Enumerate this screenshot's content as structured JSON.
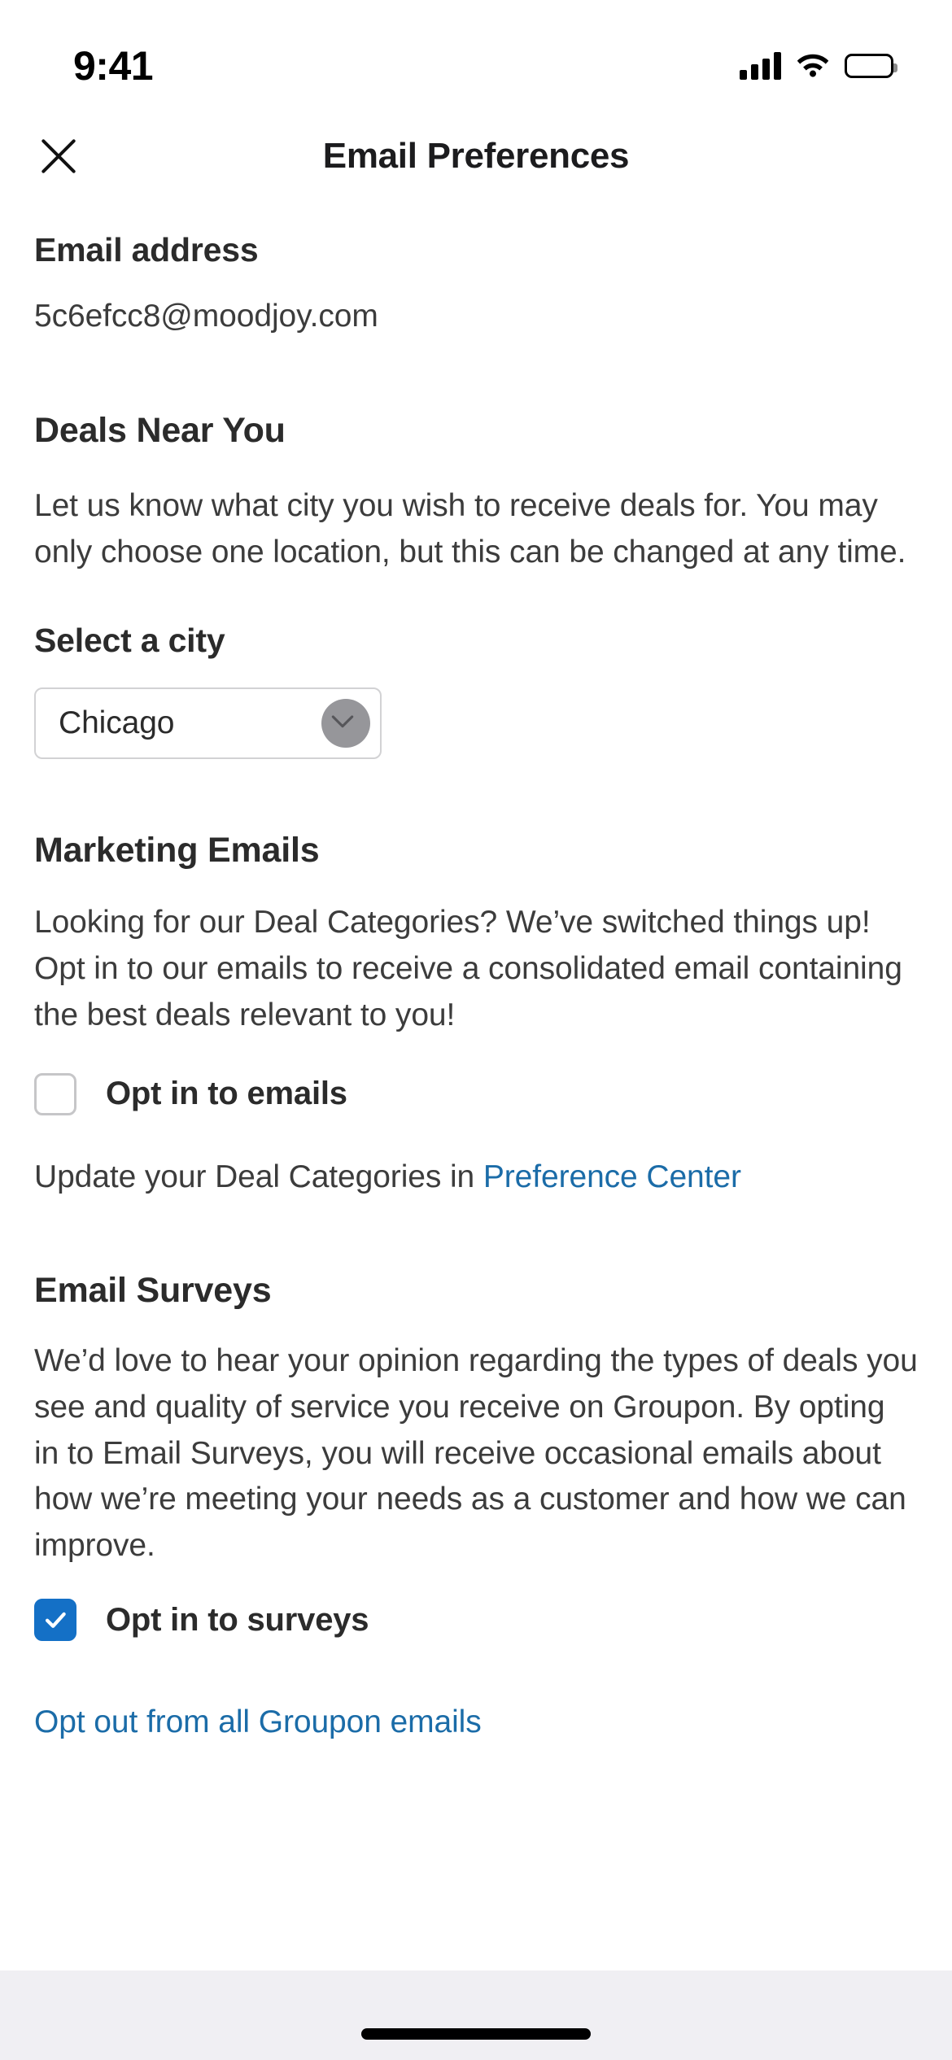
{
  "status_bar": {
    "time": "9:41",
    "cellular_icon": "signal-bars-icon",
    "wifi_icon": "wifi-icon",
    "battery_icon": "battery-full-icon"
  },
  "header": {
    "close_icon": "close-icon",
    "title": "Email Preferences"
  },
  "email_section": {
    "label": "Email address",
    "value": "5c6efcc8@moodjoy.com"
  },
  "deals_section": {
    "title": "Deals Near You",
    "description": "Let us know what city you wish to receive deals for. You may only choose one location, but this can be changed at any time.",
    "select_label": "Select a city",
    "selected_city": "Chicago",
    "chevron_icon": "chevron-down-icon",
    "cursor": "pointer-cursor"
  },
  "marketing_section": {
    "title": "Marketing Emails",
    "description": "Looking for our Deal Categories? We’ve switched things up! Opt in to our emails to receive a consolidated email containing the best deals relevant to you!",
    "checkbox_label": "Opt in to emails",
    "checkbox_checked": false,
    "footer_prefix": "Update your Deal Categories in ",
    "footer_link": "Preference Center"
  },
  "surveys_section": {
    "title": "Email Surveys",
    "description": "We’d love to hear your opinion regarding the types of deals you see and quality of service you receive on Groupon. By opting in to Email Surveys, you will receive occasional emails about how we’re meeting your needs as a customer and how we can improve.",
    "checkbox_label": "Opt in to surveys",
    "checkbox_checked": true
  },
  "footer": {
    "opt_out_link": "Opt out from all Groupon emails"
  },
  "colors": {
    "link": "#1b6ca8",
    "checkbox_checked": "#1470c6",
    "text": "#2b2b2b",
    "body_text": "#3c3c3c",
    "border": "#d2d2d4"
  }
}
